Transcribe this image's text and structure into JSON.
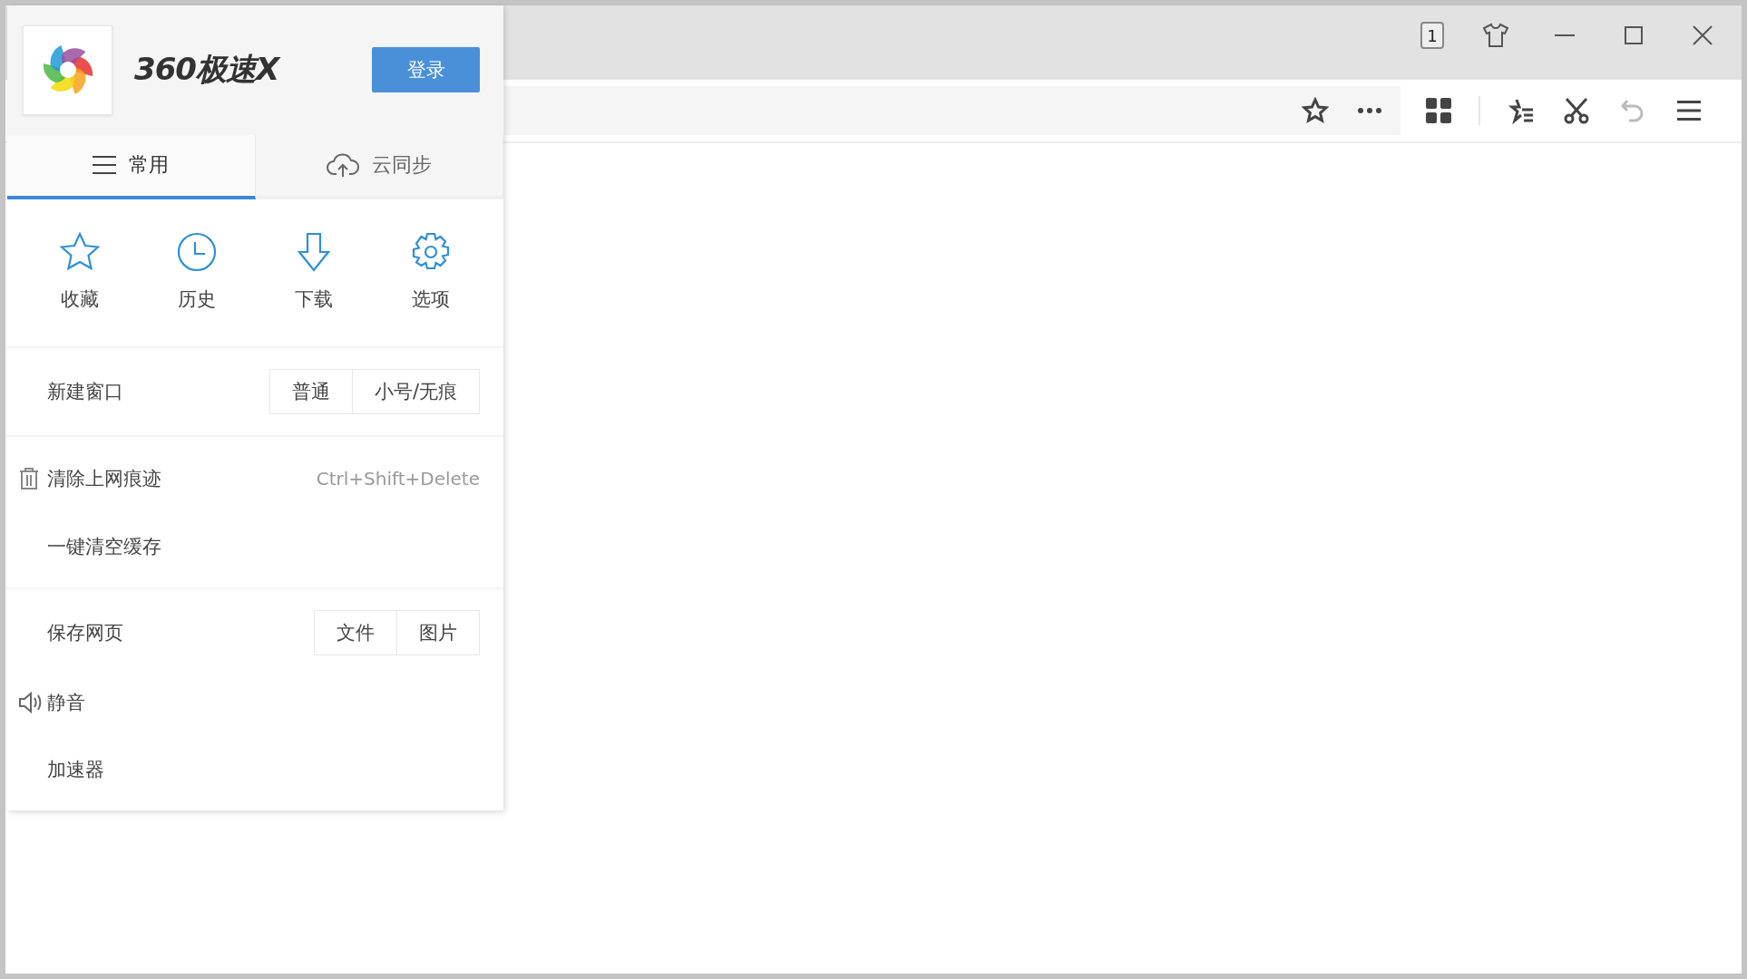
{
  "title_bar": {
    "tab_count": "1"
  },
  "toolbar": {
    "undo": {
      "disabled": true
    }
  },
  "menu": {
    "brand": "360极速X",
    "login_button": "登录",
    "tabs": [
      {
        "label": "常用",
        "selected": true
      },
      {
        "label": "云同步",
        "selected": false
      }
    ],
    "quick_actions": [
      {
        "label": "收藏"
      },
      {
        "label": "历史"
      },
      {
        "label": "下载"
      },
      {
        "label": "选项"
      }
    ],
    "groups": [
      [
        {
          "kind": "options",
          "label": "新建窗口",
          "options": [
            "普通",
            "小号/无痕"
          ]
        }
      ],
      [
        {
          "kind": "shortcut",
          "label": "清除上网痕迹",
          "shortcut": "Ctrl+Shift+Delete"
        },
        {
          "kind": "plain",
          "label": "一键清空缓存"
        }
      ],
      [
        {
          "kind": "options",
          "label": "保存网页",
          "options": [
            "文件",
            "图片"
          ]
        },
        {
          "kind": "mute",
          "label": "静音"
        },
        {
          "kind": "plain",
          "label": "加速器"
        }
      ]
    ]
  }
}
